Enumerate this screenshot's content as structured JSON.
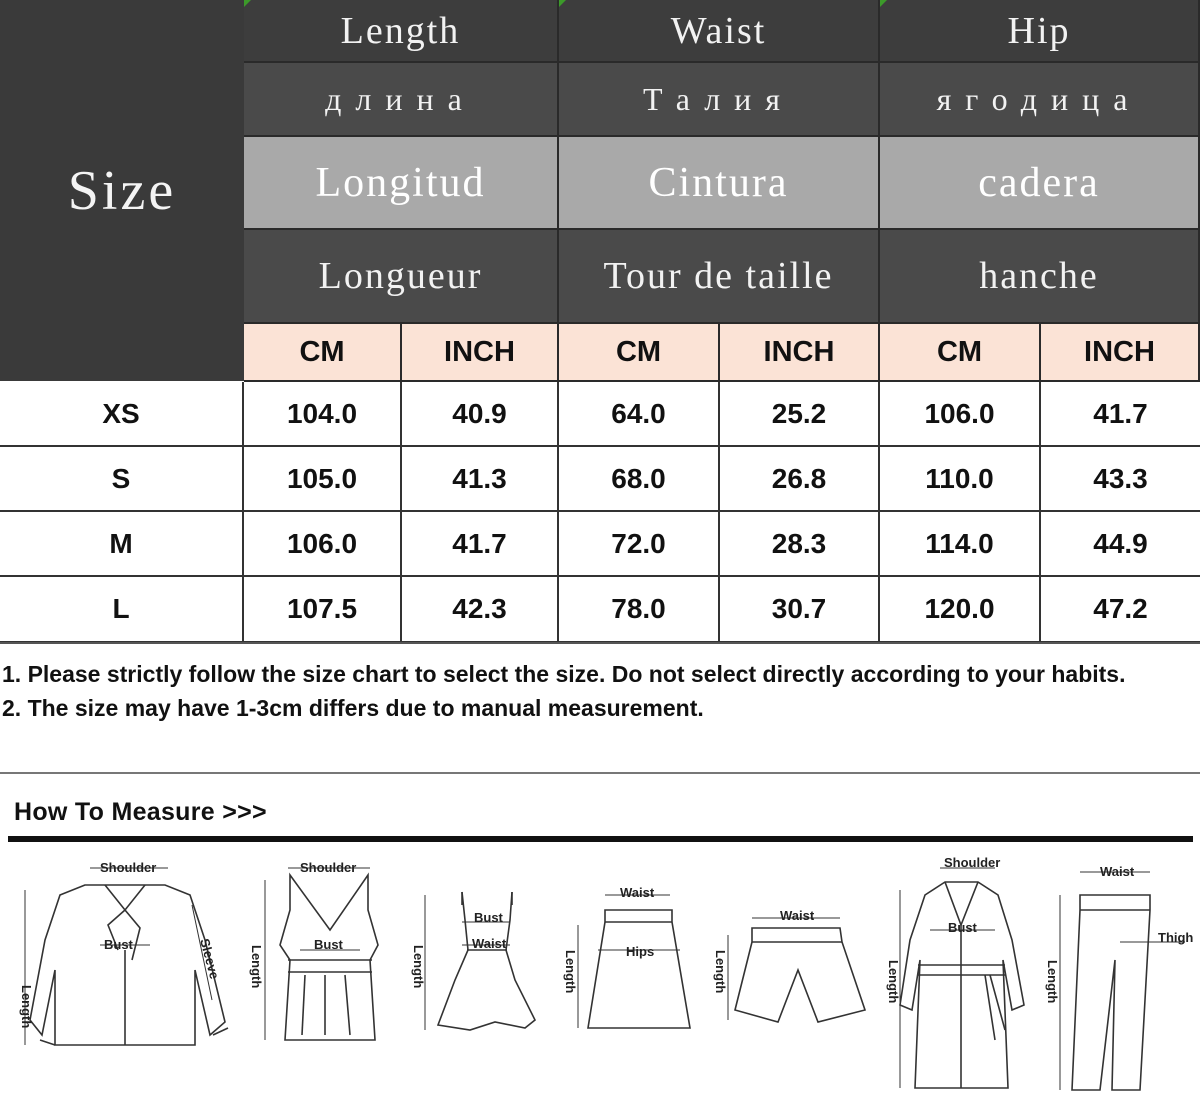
{
  "size_label": "Size",
  "columns": [
    {
      "en": "Length",
      "ru": "длина",
      "es": "Longitud",
      "fr": "Longueur"
    },
    {
      "en": "Waist",
      "ru": "Талия",
      "es": "Cintura",
      "fr": "Tour de taille"
    },
    {
      "en": "Hip",
      "ru": "ягодица",
      "es": "cadera",
      "fr": "hanche"
    }
  ],
  "units": [
    "CM",
    "INCH",
    "CM",
    "INCH",
    "CM",
    "INCH"
  ],
  "rows": [
    {
      "size": "XS",
      "values": [
        "104.0",
        "40.9",
        "64.0",
        "25.2",
        "106.0",
        "41.7"
      ]
    },
    {
      "size": "S",
      "values": [
        "105.0",
        "41.3",
        "68.0",
        "26.8",
        "110.0",
        "43.3"
      ]
    },
    {
      "size": "M",
      "values": [
        "106.0",
        "41.7",
        "72.0",
        "28.3",
        "114.0",
        "44.9"
      ]
    },
    {
      "size": "L",
      "values": [
        "107.5",
        "42.3",
        "78.0",
        "30.7",
        "120.0",
        "47.2"
      ]
    }
  ],
  "notes": [
    "1. Please strictly follow the size chart to select the size. Do not select directly according to your habits.",
    "2. The size may have 1-3cm differs due to manual measurement."
  ],
  "how_to_measure": {
    "title": "How To Measure >>>",
    "labels": {
      "shoulder": "Shoulder",
      "bust": "Bust",
      "waist": "Waist",
      "hips": "Hips",
      "length": "Length",
      "sleeve": "Sleeve",
      "thigh": "Thigh"
    }
  },
  "colors": {
    "header_dark": "#3d3d3d",
    "header_light": "#a9a9a9",
    "unit_row": "#fbe3d6",
    "accent_corner": "#3c9a2a"
  }
}
